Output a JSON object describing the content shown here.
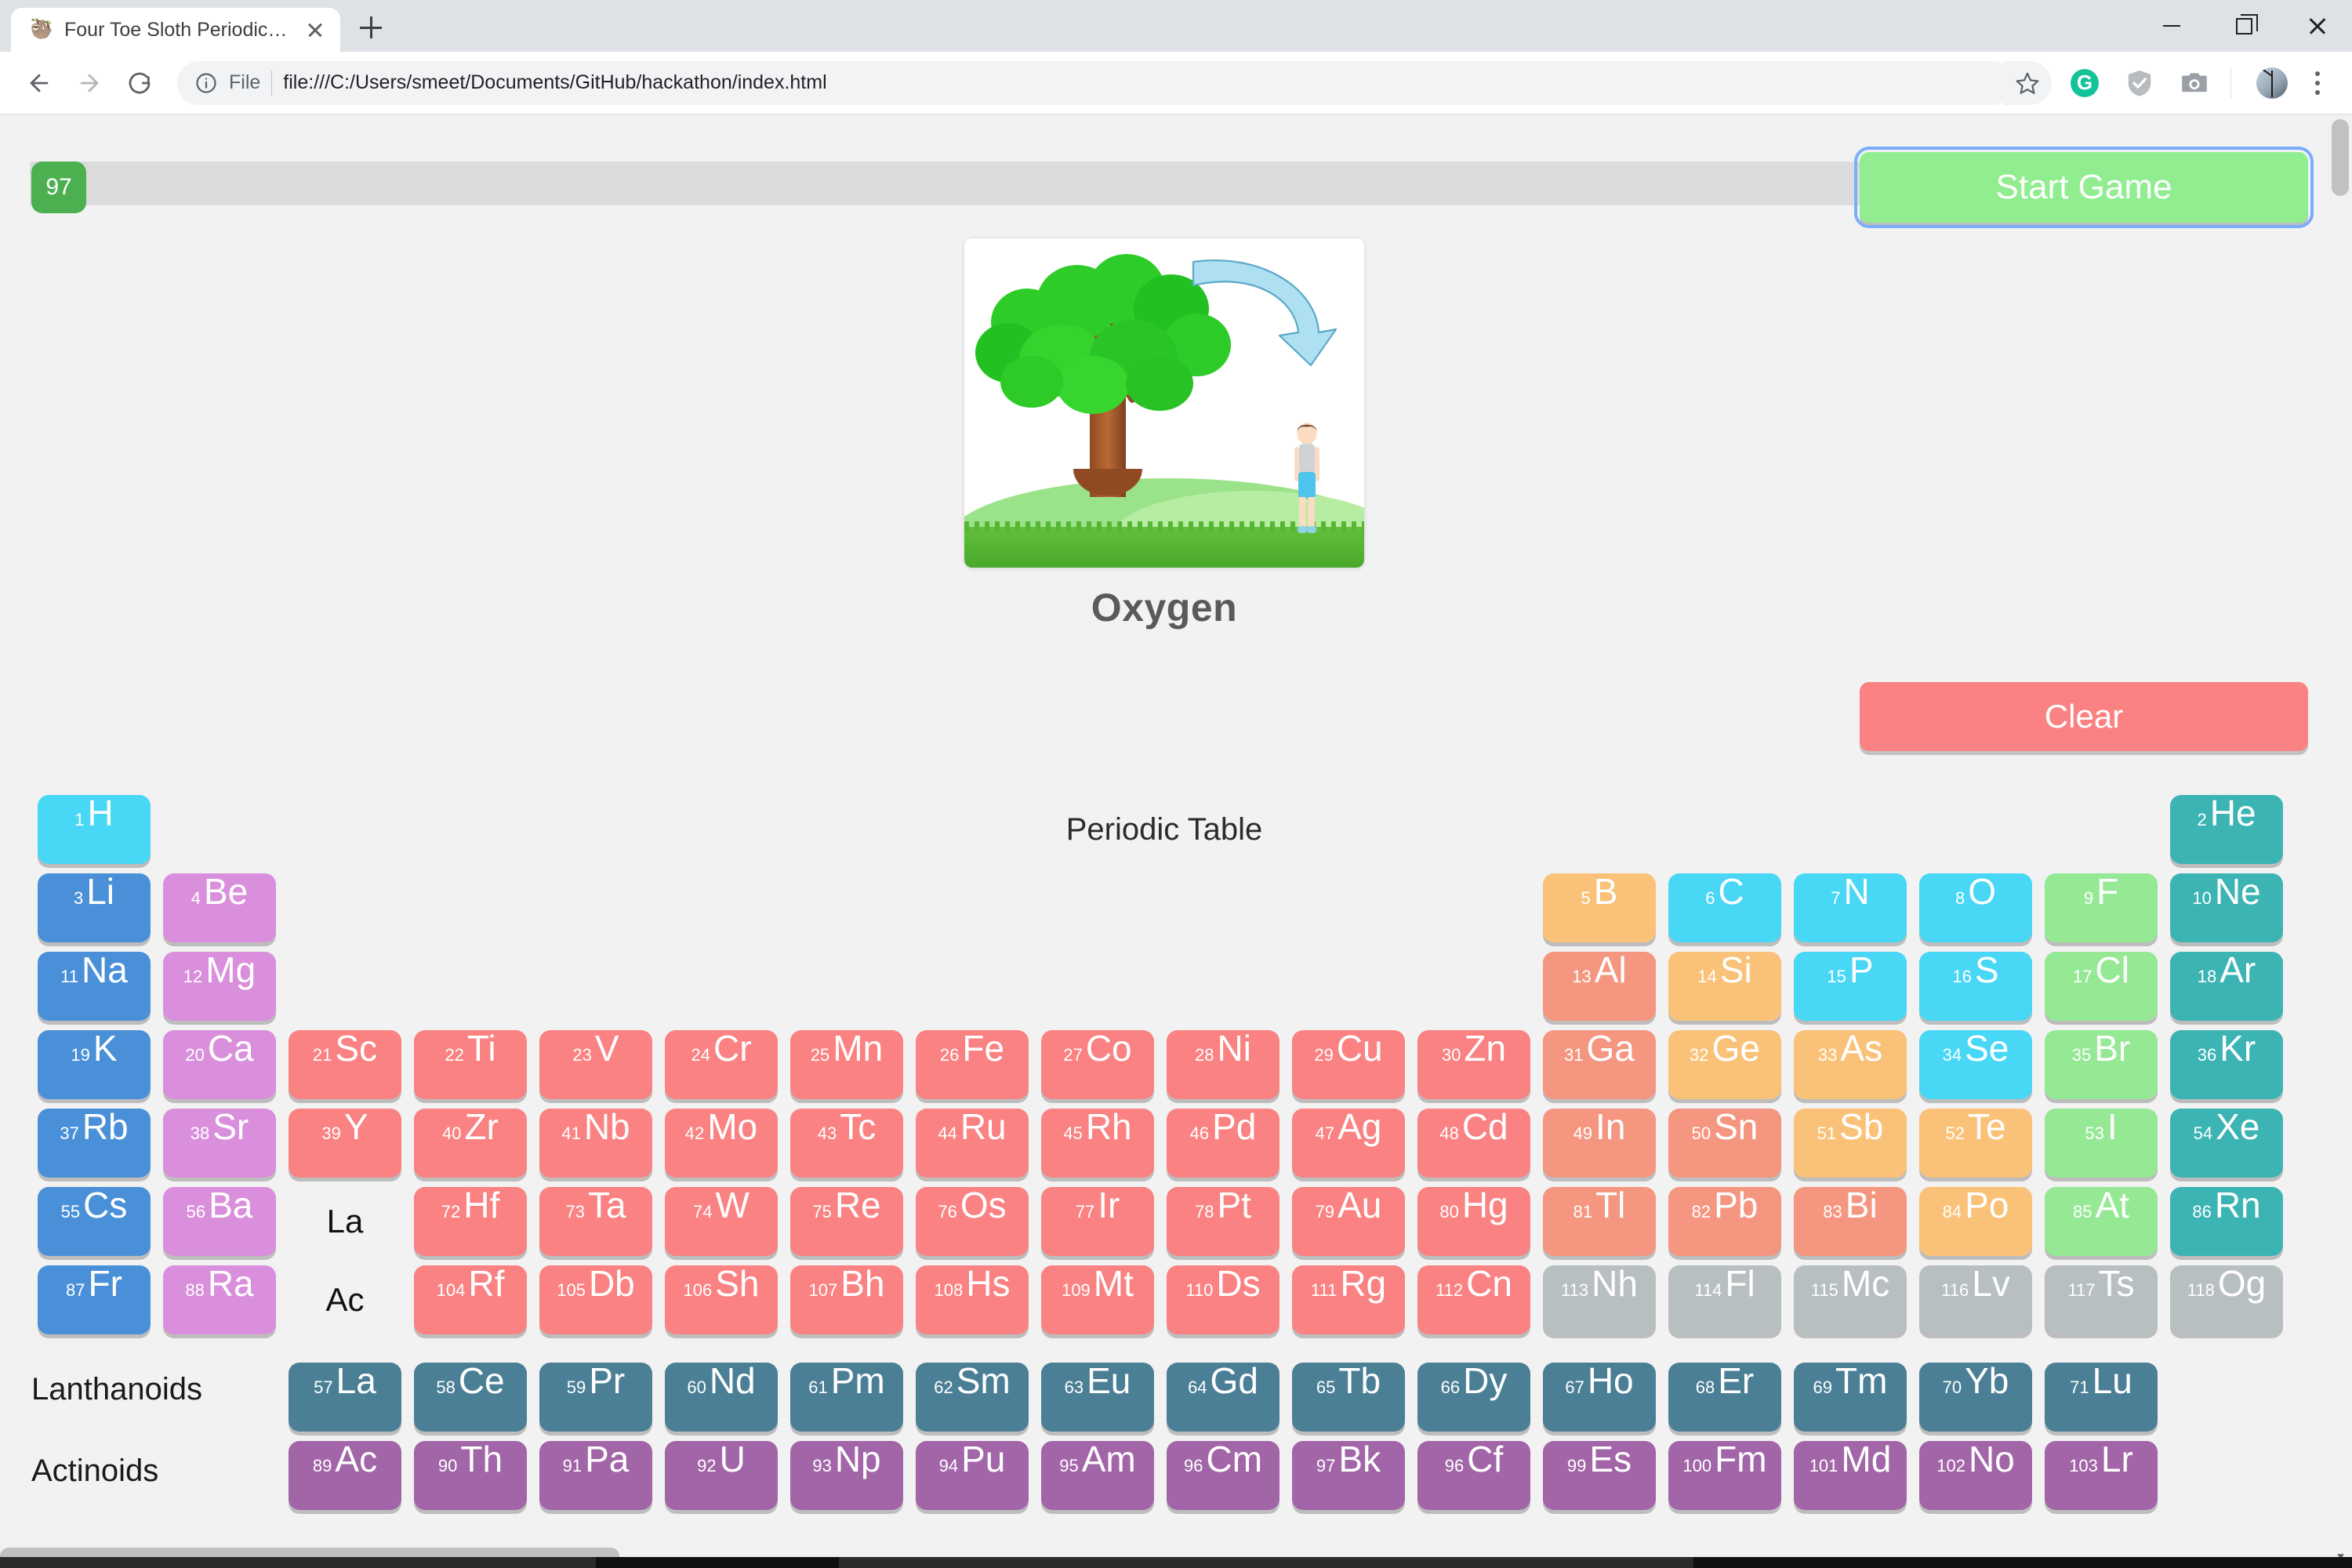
{
  "browser": {
    "tab": {
      "title": "Four Toe Sloth Periodic Table",
      "favicon": "sloth-icon"
    },
    "newtab_label": "+",
    "window_controls": {
      "minimize": "minimize-icon",
      "maximize": "maximize-icon",
      "close": "close-icon"
    },
    "omnibox": {
      "scheme_label": "File",
      "url": "file:///C:/Users/smeet/Documents/GitHub/hackathon/index.html",
      "info_icon": "info-circle-icon"
    },
    "toolbar_icons": [
      "star-icon",
      "grammarly-icon",
      "adguard-shield-icon",
      "screenshot-camera-icon",
      "profile-avatar",
      "kebab-menu-icon"
    ],
    "grammarly_letter": "G"
  },
  "game": {
    "score": "97",
    "start_button": "Start Game",
    "clear_button": "Clear",
    "prompt_caption": "Oxygen",
    "prompt_image_alt": "tree-to-person-oxygen-illustration"
  },
  "periodic_table": {
    "title": "Periodic Table",
    "lanthanoid_label": "Lanthanoids",
    "actinoid_label": "Actinoids",
    "placeholder_la": "La",
    "placeholder_ac": "Ac",
    "colors": {
      "alkali": "#4a90d9",
      "alkaline": "#da8fdc",
      "hydrogen": "#48d7f5",
      "transition": "#fa8282",
      "post_transition": "#f59680",
      "metalloid": "#fac279",
      "nonmetal": "#48d7f5",
      "halogen": "#95e894",
      "noble": "#3cb4b4",
      "lanthanoid": "#4b7f96",
      "actinoid": "#a265a8",
      "unknown": "#b8bfc1",
      "score_badge": "#4caf50",
      "start_button": "#90ee90",
      "clear_button": "#fa8282",
      "progress_track": "#dcdcdc"
    },
    "main_rows": [
      [
        {
          "n": "1",
          "s": "H",
          "c": "hydrogen"
        },
        null,
        null,
        null,
        null,
        null,
        null,
        null,
        null,
        null,
        null,
        null,
        null,
        null,
        null,
        null,
        null,
        {
          "n": "2",
          "s": "He",
          "c": "noble"
        }
      ],
      [
        {
          "n": "3",
          "s": "Li",
          "c": "alkali"
        },
        {
          "n": "4",
          "s": "Be",
          "c": "alkaline"
        },
        null,
        null,
        null,
        null,
        null,
        null,
        null,
        null,
        null,
        null,
        {
          "n": "5",
          "s": "B",
          "c": "metalloid"
        },
        {
          "n": "6",
          "s": "C",
          "c": "nonmetal"
        },
        {
          "n": "7",
          "s": "N",
          "c": "nonmetal"
        },
        {
          "n": "8",
          "s": "O",
          "c": "nonmetal"
        },
        {
          "n": "9",
          "s": "F",
          "c": "halogen"
        },
        {
          "n": "10",
          "s": "Ne",
          "c": "noble"
        }
      ],
      [
        {
          "n": "11",
          "s": "Na",
          "c": "alkali"
        },
        {
          "n": "12",
          "s": "Mg",
          "c": "alkaline"
        },
        null,
        null,
        null,
        null,
        null,
        null,
        null,
        null,
        null,
        null,
        {
          "n": "13",
          "s": "Al",
          "c": "post_transition"
        },
        {
          "n": "14",
          "s": "Si",
          "c": "metalloid"
        },
        {
          "n": "15",
          "s": "P",
          "c": "nonmetal"
        },
        {
          "n": "16",
          "s": "S",
          "c": "nonmetal"
        },
        {
          "n": "17",
          "s": "Cl",
          "c": "halogen"
        },
        {
          "n": "18",
          "s": "Ar",
          "c": "noble"
        }
      ],
      [
        {
          "n": "19",
          "s": "K",
          "c": "alkali"
        },
        {
          "n": "20",
          "s": "Ca",
          "c": "alkaline"
        },
        {
          "n": "21",
          "s": "Sc",
          "c": "transition"
        },
        {
          "n": "22",
          "s": "Ti",
          "c": "transition"
        },
        {
          "n": "23",
          "s": "V",
          "c": "transition"
        },
        {
          "n": "24",
          "s": "Cr",
          "c": "transition"
        },
        {
          "n": "25",
          "s": "Mn",
          "c": "transition"
        },
        {
          "n": "26",
          "s": "Fe",
          "c": "transition"
        },
        {
          "n": "27",
          "s": "Co",
          "c": "transition"
        },
        {
          "n": "28",
          "s": "Ni",
          "c": "transition"
        },
        {
          "n": "29",
          "s": "Cu",
          "c": "transition"
        },
        {
          "n": "30",
          "s": "Zn",
          "c": "transition"
        },
        {
          "n": "31",
          "s": "Ga",
          "c": "post_transition"
        },
        {
          "n": "32",
          "s": "Ge",
          "c": "metalloid"
        },
        {
          "n": "33",
          "s": "As",
          "c": "metalloid"
        },
        {
          "n": "34",
          "s": "Se",
          "c": "nonmetal"
        },
        {
          "n": "35",
          "s": "Br",
          "c": "halogen"
        },
        {
          "n": "36",
          "s": "Kr",
          "c": "noble"
        }
      ],
      [
        {
          "n": "37",
          "s": "Rb",
          "c": "alkali"
        },
        {
          "n": "38",
          "s": "Sr",
          "c": "alkaline"
        },
        {
          "n": "39",
          "s": "Y",
          "c": "transition"
        },
        {
          "n": "40",
          "s": "Zr",
          "c": "transition"
        },
        {
          "n": "41",
          "s": "Nb",
          "c": "transition"
        },
        {
          "n": "42",
          "s": "Mo",
          "c": "transition"
        },
        {
          "n": "43",
          "s": "Tc",
          "c": "transition"
        },
        {
          "n": "44",
          "s": "Ru",
          "c": "transition"
        },
        {
          "n": "45",
          "s": "Rh",
          "c": "transition"
        },
        {
          "n": "46",
          "s": "Pd",
          "c": "transition"
        },
        {
          "n": "47",
          "s": "Ag",
          "c": "transition"
        },
        {
          "n": "48",
          "s": "Cd",
          "c": "transition"
        },
        {
          "n": "49",
          "s": "In",
          "c": "post_transition"
        },
        {
          "n": "50",
          "s": "Sn",
          "c": "post_transition"
        },
        {
          "n": "51",
          "s": "Sb",
          "c": "metalloid"
        },
        {
          "n": "52",
          "s": "Te",
          "c": "metalloid"
        },
        {
          "n": "53",
          "s": "I",
          "c": "halogen"
        },
        {
          "n": "54",
          "s": "Xe",
          "c": "noble"
        }
      ],
      [
        {
          "n": "55",
          "s": "Cs",
          "c": "alkali"
        },
        {
          "n": "56",
          "s": "Ba",
          "c": "alkaline"
        },
        {
          "placeholder": "La"
        },
        {
          "n": "72",
          "s": "Hf",
          "c": "transition"
        },
        {
          "n": "73",
          "s": "Ta",
          "c": "transition"
        },
        {
          "n": "74",
          "s": "W",
          "c": "transition"
        },
        {
          "n": "75",
          "s": "Re",
          "c": "transition"
        },
        {
          "n": "76",
          "s": "Os",
          "c": "transition"
        },
        {
          "n": "77",
          "s": "Ir",
          "c": "transition"
        },
        {
          "n": "78",
          "s": "Pt",
          "c": "transition"
        },
        {
          "n": "79",
          "s": "Au",
          "c": "transition"
        },
        {
          "n": "80",
          "s": "Hg",
          "c": "transition"
        },
        {
          "n": "81",
          "s": "Tl",
          "c": "post_transition"
        },
        {
          "n": "82",
          "s": "Pb",
          "c": "post_transition"
        },
        {
          "n": "83",
          "s": "Bi",
          "c": "post_transition"
        },
        {
          "n": "84",
          "s": "Po",
          "c": "metalloid"
        },
        {
          "n": "85",
          "s": "At",
          "c": "halogen"
        },
        {
          "n": "86",
          "s": "Rn",
          "c": "noble"
        }
      ],
      [
        {
          "n": "87",
          "s": "Fr",
          "c": "alkali"
        },
        {
          "n": "88",
          "s": "Ra",
          "c": "alkaline"
        },
        {
          "placeholder": "Ac"
        },
        {
          "n": "104",
          "s": "Rf",
          "c": "transition"
        },
        {
          "n": "105",
          "s": "Db",
          "c": "transition"
        },
        {
          "n": "106",
          "s": "Sh",
          "c": "transition"
        },
        {
          "n": "107",
          "s": "Bh",
          "c": "transition"
        },
        {
          "n": "108",
          "s": "Hs",
          "c": "transition"
        },
        {
          "n": "109",
          "s": "Mt",
          "c": "transition"
        },
        {
          "n": "110",
          "s": "Ds",
          "c": "transition"
        },
        {
          "n": "111",
          "s": "Rg",
          "c": "transition"
        },
        {
          "n": "112",
          "s": "Cn",
          "c": "transition"
        },
        {
          "n": "113",
          "s": "Nh",
          "c": "unknown"
        },
        {
          "n": "114",
          "s": "Fl",
          "c": "unknown"
        },
        {
          "n": "115",
          "s": "Mc",
          "c": "unknown"
        },
        {
          "n": "116",
          "s": "Lv",
          "c": "unknown"
        },
        {
          "n": "117",
          "s": "Ts",
          "c": "unknown"
        },
        {
          "n": "118",
          "s": "Og",
          "c": "unknown"
        }
      ]
    ],
    "lanthanoids": [
      {
        "n": "57",
        "s": "La",
        "c": "lanthanoid"
      },
      {
        "n": "58",
        "s": "Ce",
        "c": "lanthanoid"
      },
      {
        "n": "59",
        "s": "Pr",
        "c": "lanthanoid"
      },
      {
        "n": "60",
        "s": "Nd",
        "c": "lanthanoid"
      },
      {
        "n": "61",
        "s": "Pm",
        "c": "lanthanoid"
      },
      {
        "n": "62",
        "s": "Sm",
        "c": "lanthanoid"
      },
      {
        "n": "63",
        "s": "Eu",
        "c": "lanthanoid"
      },
      {
        "n": "64",
        "s": "Gd",
        "c": "lanthanoid"
      },
      {
        "n": "65",
        "s": "Tb",
        "c": "lanthanoid"
      },
      {
        "n": "66",
        "s": "Dy",
        "c": "lanthanoid"
      },
      {
        "n": "67",
        "s": "Ho",
        "c": "lanthanoid"
      },
      {
        "n": "68",
        "s": "Er",
        "c": "lanthanoid"
      },
      {
        "n": "69",
        "s": "Tm",
        "c": "lanthanoid"
      },
      {
        "n": "70",
        "s": "Yb",
        "c": "lanthanoid"
      },
      {
        "n": "71",
        "s": "Lu",
        "c": "lanthanoid"
      }
    ],
    "actinoids": [
      {
        "n": "89",
        "s": "Ac",
        "c": "actinoid"
      },
      {
        "n": "90",
        "s": "Th",
        "c": "actinoid"
      },
      {
        "n": "91",
        "s": "Pa",
        "c": "actinoid"
      },
      {
        "n": "92",
        "s": "U",
        "c": "actinoid"
      },
      {
        "n": "93",
        "s": "Np",
        "c": "actinoid"
      },
      {
        "n": "94",
        "s": "Pu",
        "c": "actinoid"
      },
      {
        "n": "95",
        "s": "Am",
        "c": "actinoid"
      },
      {
        "n": "96",
        "s": "Cm",
        "c": "actinoid"
      },
      {
        "n": "97",
        "s": "Bk",
        "c": "actinoid"
      },
      {
        "n": "96",
        "s": "Cf",
        "c": "actinoid"
      },
      {
        "n": "99",
        "s": "Es",
        "c": "actinoid"
      },
      {
        "n": "100",
        "s": "Fm",
        "c": "actinoid"
      },
      {
        "n": "101",
        "s": "Md",
        "c": "actinoid"
      },
      {
        "n": "102",
        "s": "No",
        "c": "actinoid"
      },
      {
        "n": "103",
        "s": "Lr",
        "c": "actinoid"
      }
    ]
  }
}
